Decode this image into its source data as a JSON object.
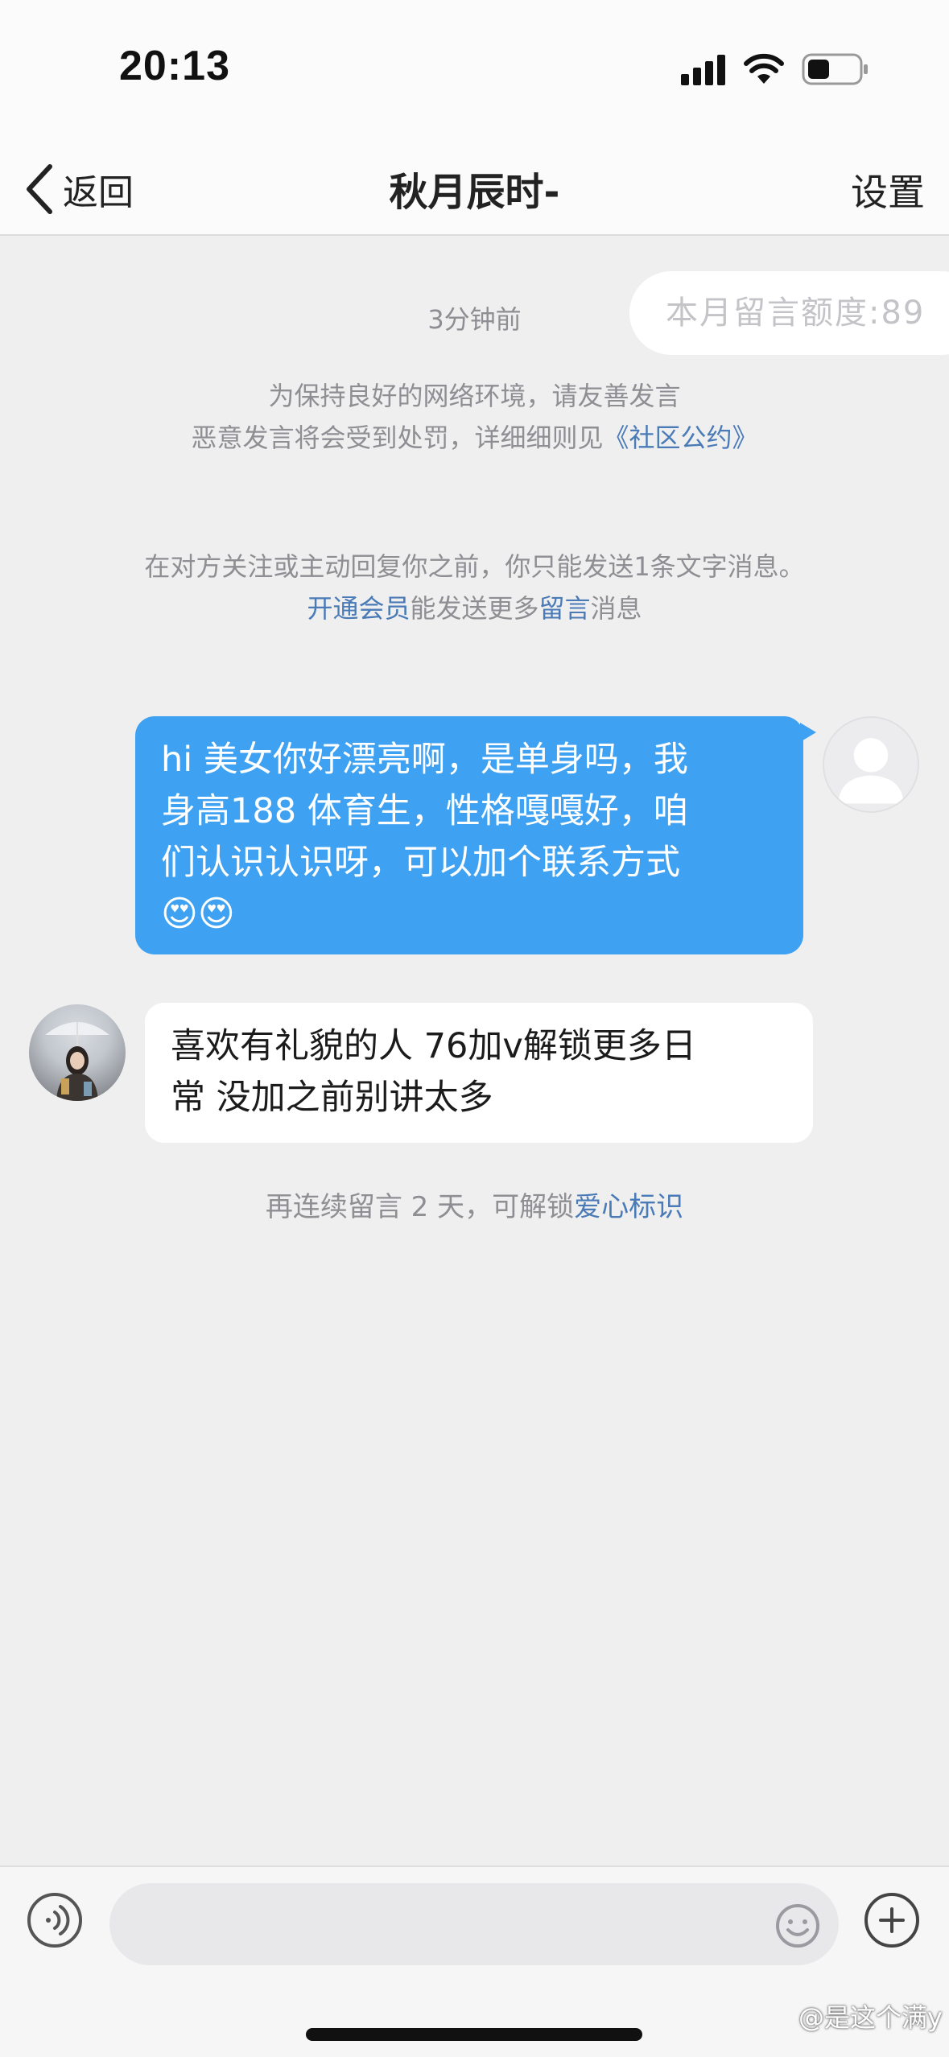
{
  "status_bar": {
    "time": "20:13"
  },
  "nav": {
    "back_label": "返回",
    "title": "秋月辰时-",
    "settings_label": "设置"
  },
  "quota": {
    "text": "本月留言额度:89"
  },
  "timestamp": "3分钟前",
  "community_notice": {
    "line1": "为保持良好的网络环境，请友善发言",
    "line2_prefix": "恶意发言将会受到处罚，详细细则见",
    "line2_link": "《社区公约》"
  },
  "limit_notice": {
    "line1": "在对方关注或主动回复你之前，你只能发送1条文字消息。",
    "link_vip": "开通会员",
    "mid": "能发送更多",
    "link_msg": "留言",
    "suffix": "消息"
  },
  "messages": [
    {
      "sender": "me",
      "lines": [
        "hi 美女你好漂亮啊，是单身吗，我",
        "身高188 体育生，性格嘎嘎好，咱",
        "们认识认识呀，可以加个联系方式"
      ],
      "emoji": "😍😍"
    },
    {
      "sender": "other",
      "lines": [
        "喜欢有礼貌的人 76加v解锁更多日",
        "常  没加之前别讲太多"
      ]
    }
  ],
  "streak_notice": {
    "prefix": "再连续留言 2 天，可解锁",
    "link": "爱心标识"
  },
  "input": {
    "placeholder": ""
  },
  "watermark": "@是这个满y",
  "colors": {
    "accent_blue": "#3fa1f2",
    "link_blue": "#4a7bb7",
    "background": "#efeff0"
  }
}
